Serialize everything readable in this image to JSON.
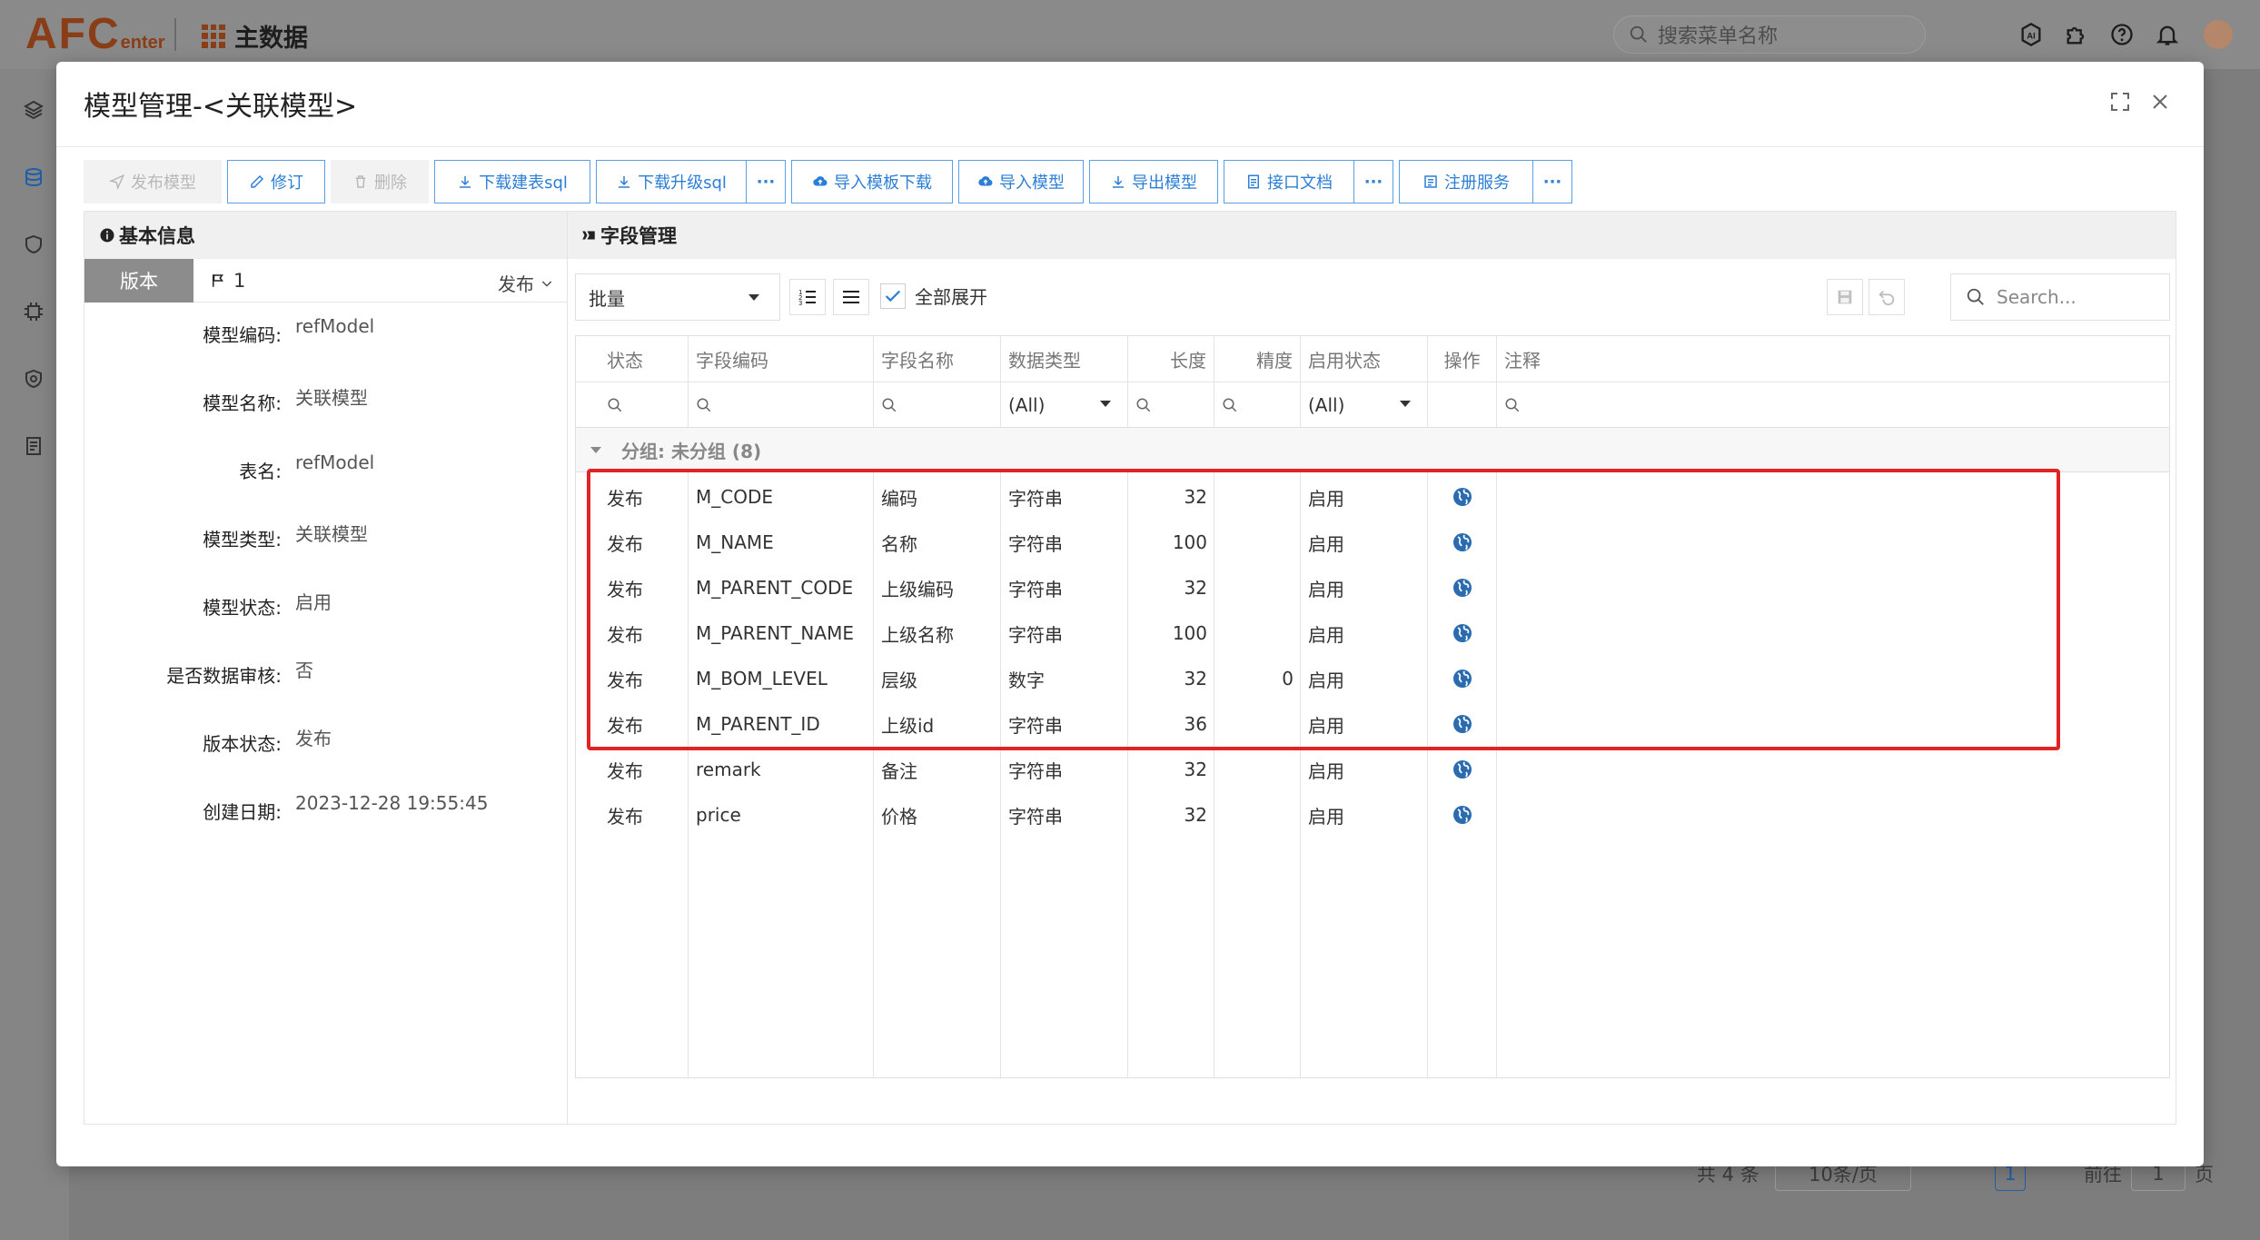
{
  "app": {
    "logo_main": "AFC",
    "logo_sub": "enter",
    "title": "主数据",
    "search_placeholder": "搜索菜单名称"
  },
  "background_pager": {
    "total": "共 4 条",
    "page_size": "10条/页",
    "current_page": "1",
    "goto_label": "前往",
    "goto_value": "1",
    "page_suffix": "页"
  },
  "modal": {
    "title": "模型管理-<关联模型>",
    "toolbar": {
      "publish": "发布模型",
      "revise": "修订",
      "delete": "删除",
      "download_create_sql": "下载建表sql",
      "download_upgrade_sql": "下载升级sql",
      "import_template_download": "导入模板下载",
      "import_model": "导入模型",
      "export_model": "导出模型",
      "api_docs": "接口文档",
      "register_service": "注册服务",
      "more": "···"
    },
    "basic_info": {
      "heading": "基本信息",
      "version_tag": "版本",
      "version_number": "1",
      "version_status": "发布",
      "rows": [
        {
          "label": "模型编码:",
          "value": "refModel"
        },
        {
          "label": "模型名称:",
          "value": "关联模型"
        },
        {
          "label": "表名:",
          "value": "refModel"
        },
        {
          "label": "模型类型:",
          "value": "关联模型"
        },
        {
          "label": "模型状态:",
          "value": "启用"
        },
        {
          "label": "是否数据审核:",
          "value": "否"
        },
        {
          "label": "版本状态:",
          "value": "发布"
        },
        {
          "label": "创建日期:",
          "value": "2023-12-28 19:55:45"
        }
      ]
    },
    "fields": {
      "heading": "字段管理",
      "batch_label": "批量",
      "expand_all_label": "全部展开",
      "search_placeholder": "Search...",
      "columns": [
        "状态",
        "字段编码",
        "字段名称",
        "数据类型",
        "长度",
        "精度",
        "启用状态",
        "操作",
        "注释"
      ],
      "filter_all": "(All)",
      "group_label": "分组: 未分组 (8)",
      "rows": [
        {
          "status": "发布",
          "code": "M_CODE",
          "name": "编码",
          "type": "字符串",
          "length": "32",
          "precision": "",
          "enabled": "启用"
        },
        {
          "status": "发布",
          "code": "M_NAME",
          "name": "名称",
          "type": "字符串",
          "length": "100",
          "precision": "",
          "enabled": "启用"
        },
        {
          "status": "发布",
          "code": "M_PARENT_CODE",
          "name": "上级编码",
          "type": "字符串",
          "length": "32",
          "precision": "",
          "enabled": "启用"
        },
        {
          "status": "发布",
          "code": "M_PARENT_NAME",
          "name": "上级名称",
          "type": "字符串",
          "length": "100",
          "precision": "",
          "enabled": "启用"
        },
        {
          "status": "发布",
          "code": "M_BOM_LEVEL",
          "name": "层级",
          "type": "数字",
          "length": "32",
          "precision": "0",
          "enabled": "启用"
        },
        {
          "status": "发布",
          "code": "M_PARENT_ID",
          "name": "上级id",
          "type": "字符串",
          "length": "36",
          "precision": "",
          "enabled": "启用"
        },
        {
          "status": "发布",
          "code": "remark",
          "name": "备注",
          "type": "字符串",
          "length": "32",
          "precision": "",
          "enabled": "启用"
        },
        {
          "status": "发布",
          "code": "price",
          "name": "价格",
          "type": "字符串",
          "length": "32",
          "precision": "",
          "enabled": "启用"
        }
      ]
    }
  },
  "colors": {
    "primary_blue": "#2c7fd6",
    "highlight_red": "#e02424",
    "brand_brown": "#8a3e17",
    "globe_blue": "#2b6cb0"
  }
}
